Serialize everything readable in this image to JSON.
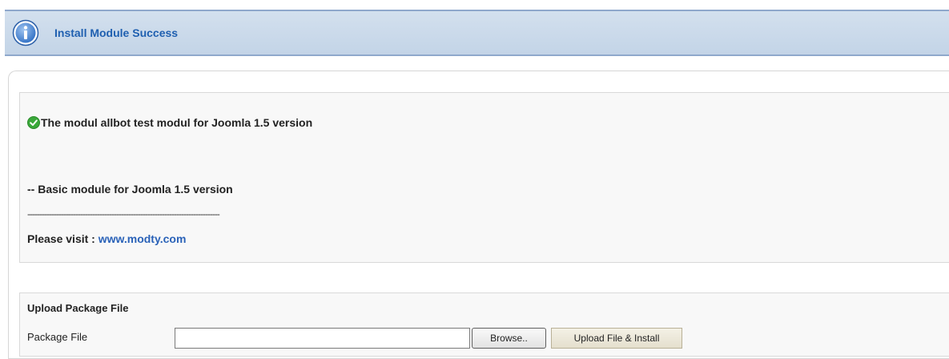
{
  "notice": {
    "title": "Install Module Success",
    "icon": "info-icon"
  },
  "message": {
    "module_line": "The modul allbot test modul for Joomla 1.5 version",
    "module_icon": "check-circle-icon",
    "description": "-- Basic module for Joomla 1.5 version",
    "separator": "--------------------------------------------------------------------------------",
    "visit_label": "Please visit :",
    "visit_link": "www.modty.com"
  },
  "upload": {
    "title": "Upload Package File",
    "package_label": "Package File",
    "file_value": "",
    "browse_label": "Browse..",
    "install_label": "Upload File & Install"
  },
  "colors": {
    "banner_bg": "#c9d8ea",
    "banner_border": "#8fa8cc",
    "title_blue": "#1f5fb0",
    "link_blue": "#2a62b8",
    "success_green": "#3aa83a"
  }
}
